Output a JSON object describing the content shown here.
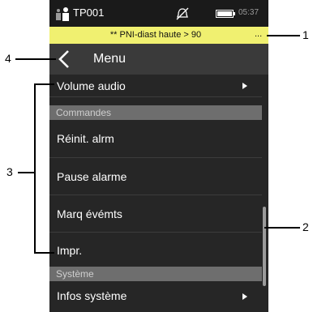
{
  "status_bar": {
    "patient_id": "TP001",
    "time": "05:37",
    "icons": [
      "person-icon",
      "alarm-off-icon",
      "battery-icon"
    ]
  },
  "alarm_bar": {
    "message": "** PNI-diast haute > 90",
    "more": "..."
  },
  "header": {
    "back_icon": "chevron-left-icon",
    "title": "Menu"
  },
  "menu": {
    "volume_audio": "Volume audio",
    "section_commandes": "Commandes",
    "reinit_alrm": "Réinit. alrm",
    "pause_alarme": "Pause alarme",
    "marq_evemts": "Marq évémts",
    "impr": "Impr.",
    "section_systeme": "Système",
    "infos_systeme": "Infos système"
  },
  "callouts": {
    "one": "1",
    "two": "2",
    "three": "3",
    "four": "4"
  },
  "colors": {
    "alarm_bar": "#f0f070",
    "screen_bg": "#262626",
    "header_bg": "#3a3a3a",
    "section_bg": "#6e6e6e"
  }
}
